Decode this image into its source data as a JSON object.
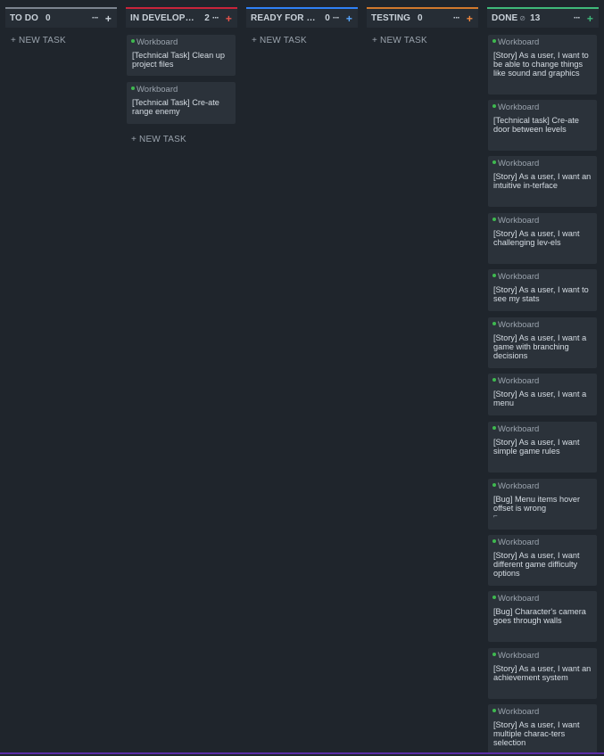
{
  "columns": [
    {
      "title": "TO DO",
      "count": "0",
      "accent": "#7d8590",
      "add_color": "#c9d1d9"
    },
    {
      "title": "IN DEVELOPM...",
      "count": "2",
      "accent": "#c9243a",
      "add_color": "#e5534b"
    },
    {
      "title": "READY FOR TE...",
      "count": "0",
      "accent": "#2f81f7",
      "add_color": "#58a6ff"
    },
    {
      "title": "TESTING",
      "count": "0",
      "accent": "#d1792c",
      "add_color": "#f0883e"
    },
    {
      "title": "DONE",
      "count": "13",
      "accent": "#3fb97a",
      "add_color": "#3fb97a"
    }
  ],
  "menu_glyph": "···",
  "add_glyph": "+",
  "done_check_glyph": "⊘",
  "new_task_label": "+ NEW TASK",
  "card_source": "Workboard",
  "in_development_cards": [
    "[Technical Task] Clean up project files",
    "[Technical Task] Cre-ate range enemy"
  ],
  "done_cards": [
    "[Story] As a user, I want to be able to change things like sound and graphics",
    "[Technical task] Cre-ate door between levels",
    "[Story] As a user, I want an intuitive in-terface",
    "[Story] As a user, I want challenging lev-els",
    "[Story] As a user, I want to see my stats",
    "[Story] As a user, I want a game with branching decisions",
    "[Story] As a user, I want a menu",
    "[Story] As a user, I want simple game rules",
    "[Bug] Menu items hover offset is wrong",
    "[Story] As a user, I want different game difficulty options",
    "[Bug] Character's camera goes through walls",
    "[Story] As a user, I want an achievement system",
    "[Story] As a user, I want multiple charac-ters selection"
  ],
  "bug_card_extra": "⌐"
}
